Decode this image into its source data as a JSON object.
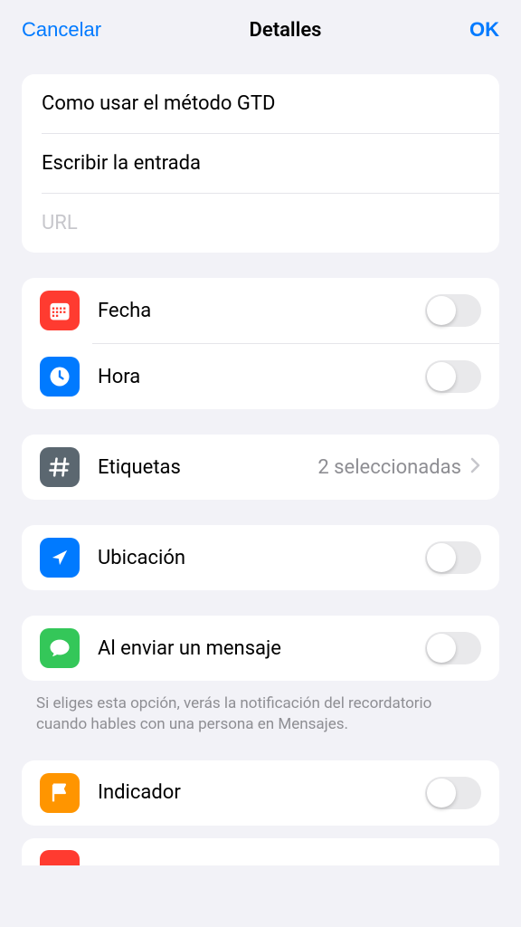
{
  "header": {
    "cancel": "Cancelar",
    "title": "Detalles",
    "ok": "OK"
  },
  "inputs": {
    "title_value": "Como usar el método GTD",
    "notes_value": "Escribir la entrada",
    "url_placeholder": "URL"
  },
  "rows": {
    "date": {
      "label": "Fecha"
    },
    "time": {
      "label": "Hora"
    },
    "tags": {
      "label": "Etiquetas",
      "value": "2 seleccionadas"
    },
    "location": {
      "label": "Ubicación"
    },
    "messaging": {
      "label": "Al enviar un mensaje"
    },
    "flag": {
      "label": "Indicador"
    }
  },
  "footer": {
    "messaging_hint": "Si eliges esta opción, verás la notificación del recordatorio cuando hables con una persona en Mensajes."
  }
}
